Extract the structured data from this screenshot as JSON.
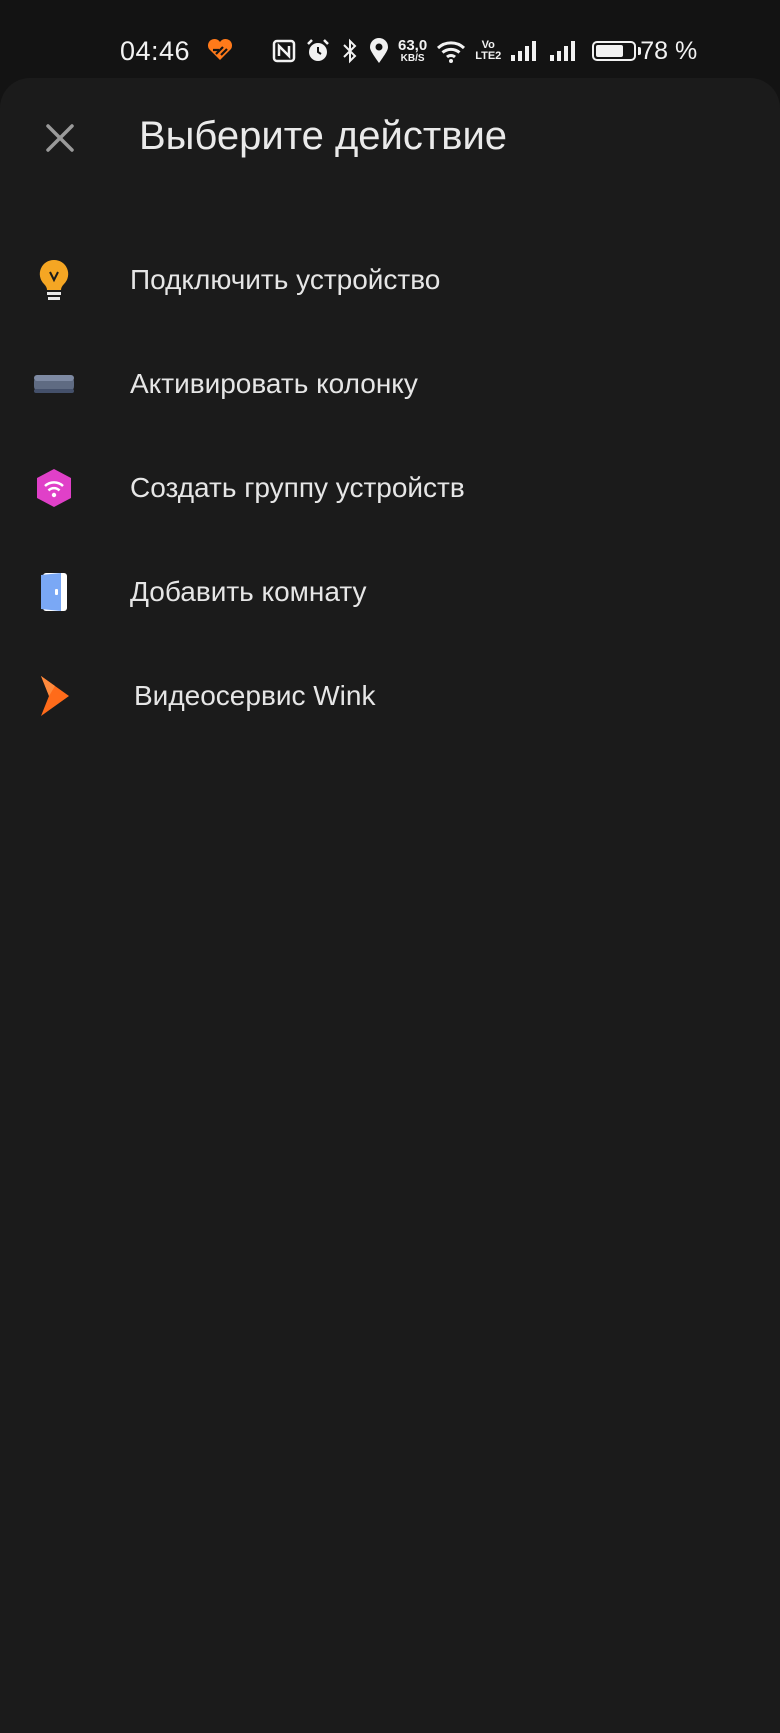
{
  "status_bar": {
    "time": "04:46",
    "net_speed_value": "63,0",
    "net_speed_unit": "KB/S",
    "volte_top": "Vo",
    "volte_bottom": "LTE2",
    "battery_level": 0.78,
    "battery_text": "78 %",
    "icons": [
      "app-heart-icon",
      "nfc-icon",
      "alarm-icon",
      "bluetooth-icon",
      "location-icon",
      "wifi-icon",
      "signal-icon",
      "signal-icon",
      "battery-icon"
    ]
  },
  "sheet": {
    "title": "Выберите действие",
    "close_icon": "close-icon"
  },
  "menu": {
    "items": [
      {
        "label": "Подключить устройство",
        "icon": "lightbulb-icon",
        "color": "#f5a623"
      },
      {
        "label": "Активировать колонку",
        "icon": "speaker-icon",
        "color": "#5f6b82"
      },
      {
        "label": "Создать группу устройств",
        "icon": "device-group-icon",
        "color": "#e040c8"
      },
      {
        "label": "Добавить комнату",
        "icon": "door-icon",
        "color": "#7aa8f5"
      },
      {
        "label": "Видеосервис Wink",
        "icon": "wink-logo-icon",
        "color": "#ff6b1a"
      }
    ]
  },
  "colors": {
    "background": "#131313",
    "sheet": "#1b1b1b",
    "text": "#e6e6e6"
  }
}
